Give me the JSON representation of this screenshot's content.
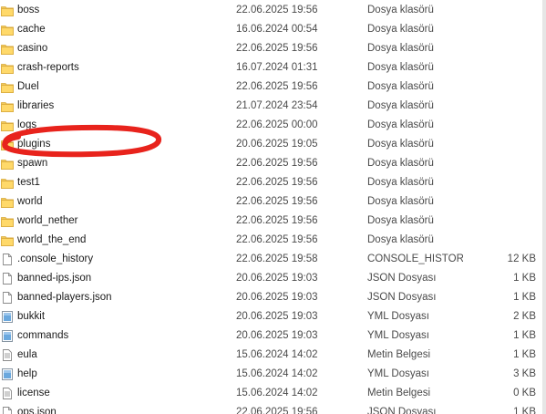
{
  "files": [
    {
      "name": "boss",
      "date": "22.06.2025 19:56",
      "type": "Dosya klasörü",
      "size": "",
      "icon": "folder-icon"
    },
    {
      "name": "cache",
      "date": "16.06.2024 00:54",
      "type": "Dosya klasörü",
      "size": "",
      "icon": "folder-icon"
    },
    {
      "name": "casino",
      "date": "22.06.2025 19:56",
      "type": "Dosya klasörü",
      "size": "",
      "icon": "folder-icon"
    },
    {
      "name": "crash-reports",
      "date": "16.07.2024 01:31",
      "type": "Dosya klasörü",
      "size": "",
      "icon": "folder-icon"
    },
    {
      "name": "Duel",
      "date": "22.06.2025 19:56",
      "type": "Dosya klasörü",
      "size": "",
      "icon": "folder-icon"
    },
    {
      "name": "libraries",
      "date": "21.07.2024 23:54",
      "type": "Dosya klasörü",
      "size": "",
      "icon": "folder-icon"
    },
    {
      "name": "logs",
      "date": "22.06.2025 00:00",
      "type": "Dosya klasörü",
      "size": "",
      "icon": "folder-icon"
    },
    {
      "name": "plugins",
      "date": "20.06.2025 19:05",
      "type": "Dosya klasörü",
      "size": "",
      "icon": "folder-icon"
    },
    {
      "name": "spawn",
      "date": "22.06.2025 19:56",
      "type": "Dosya klasörü",
      "size": "",
      "icon": "folder-icon"
    },
    {
      "name": "test1",
      "date": "22.06.2025 19:56",
      "type": "Dosya klasörü",
      "size": "",
      "icon": "folder-icon"
    },
    {
      "name": "world",
      "date": "22.06.2025 19:56",
      "type": "Dosya klasörü",
      "size": "",
      "icon": "folder-icon"
    },
    {
      "name": "world_nether",
      "date": "22.06.2025 19:56",
      "type": "Dosya klasörü",
      "size": "",
      "icon": "folder-icon"
    },
    {
      "name": "world_the_end",
      "date": "22.06.2025 19:56",
      "type": "Dosya klasörü",
      "size": "",
      "icon": "folder-icon"
    },
    {
      "name": ".console_history",
      "date": "22.06.2025 19:58",
      "type": "CONSOLE_HISTOR...",
      "size": "12 KB",
      "icon": "file-icon"
    },
    {
      "name": "banned-ips.json",
      "date": "20.06.2025 19:03",
      "type": "JSON Dosyası",
      "size": "1 KB",
      "icon": "file-icon"
    },
    {
      "name": "banned-players.json",
      "date": "20.06.2025 19:03",
      "type": "JSON Dosyası",
      "size": "1 KB",
      "icon": "file-icon"
    },
    {
      "name": "bukkit",
      "date": "20.06.2025 19:03",
      "type": "YML Dosyası",
      "size": "2 KB",
      "icon": "yml-file-icon"
    },
    {
      "name": "commands",
      "date": "20.06.2025 19:03",
      "type": "YML Dosyası",
      "size": "1 KB",
      "icon": "yml-file-icon"
    },
    {
      "name": "eula",
      "date": "15.06.2024 14:02",
      "type": "Metin Belgesi",
      "size": "1 KB",
      "icon": "text-file-icon"
    },
    {
      "name": "help",
      "date": "15.06.2024 14:02",
      "type": "YML Dosyası",
      "size": "3 KB",
      "icon": "yml-file-icon"
    },
    {
      "name": "license",
      "date": "15.06.2024 14:02",
      "type": "Metin Belgesi",
      "size": "0 KB",
      "icon": "text-file-icon"
    },
    {
      "name": "ops.json",
      "date": "22.06.2025 19:56",
      "type": "JSON Dosyası",
      "size": "1 KB",
      "icon": "file-icon"
    }
  ],
  "annotation": {
    "color": "#e8231c"
  }
}
